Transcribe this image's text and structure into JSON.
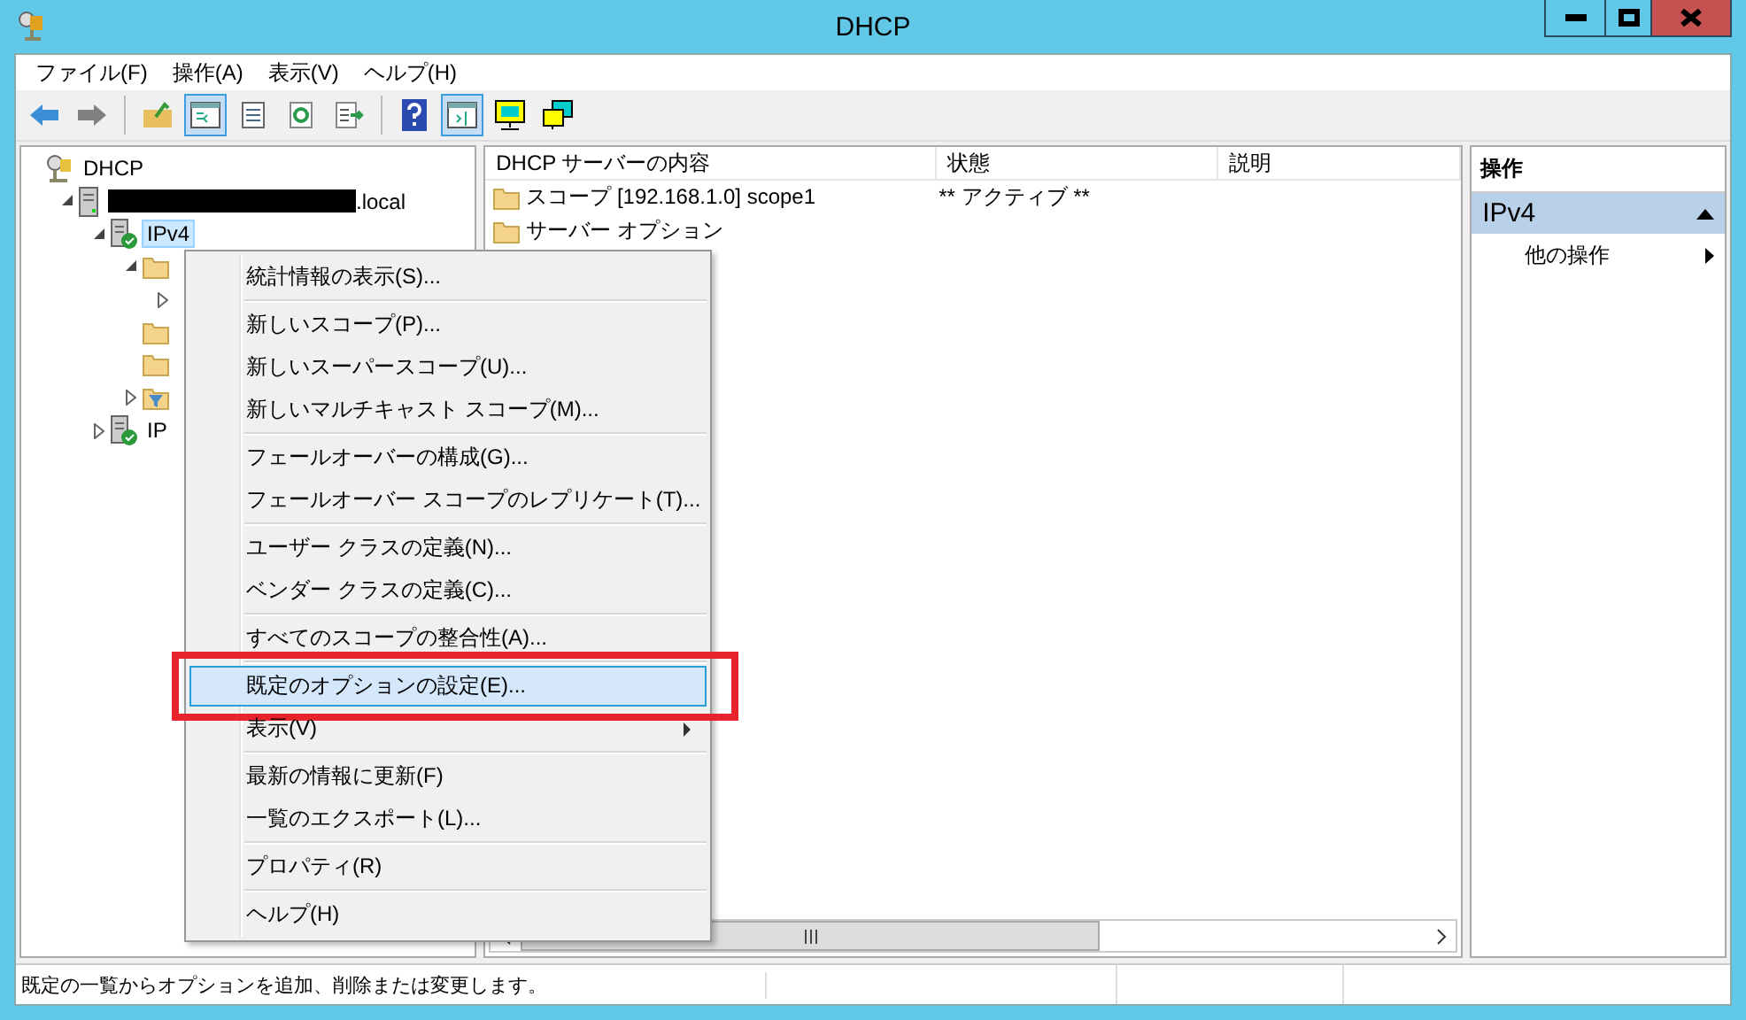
{
  "window": {
    "title": "DHCP"
  },
  "menubar": [
    "ファイル(F)",
    "操作(A)",
    "表示(V)",
    "ヘルプ(H)"
  ],
  "toolbar": [
    {
      "kind": "back",
      "pressed": false
    },
    {
      "kind": "forward",
      "pressed": false
    },
    {
      "kind": "separator"
    },
    {
      "kind": "up",
      "pressed": false
    },
    {
      "kind": "tree",
      "pressed": true
    },
    {
      "kind": "list",
      "pressed": false
    },
    {
      "kind": "refresh",
      "pressed": false
    },
    {
      "kind": "export",
      "pressed": false
    },
    {
      "kind": "separator"
    },
    {
      "kind": "help",
      "pressed": false
    },
    {
      "kind": "pane",
      "pressed": true
    },
    {
      "kind": "monitor",
      "pressed": false
    },
    {
      "kind": "monitors",
      "pressed": false
    }
  ],
  "tree": [
    {
      "kind": "dhcp",
      "label": "DHCP",
      "selected": false,
      "children": [
        {
          "kind": "server",
          "label": ".local",
          "redacted": true,
          "expanded": true,
          "selected": false,
          "children": [
            {
              "kind": "ipv4",
              "label": "IPv4",
              "expanded": true,
              "selected": true,
              "children": [
                {
                  "kind": "folder",
                  "expanded": true,
                  "children": [
                    {
                      "expanded": false
                    }
                  ]
                },
                {
                  "kind": "folder"
                },
                {
                  "kind": "folder"
                },
                {
                  "kind": "filter",
                  "expanded": false
                }
              ]
            },
            {
              "kind": "ipv4",
              "label": "IP",
              "expanded": false,
              "selected": false
            }
          ]
        }
      ]
    }
  ],
  "list": {
    "columns": [
      "DHCP サーバーの内容",
      "状態",
      "説明"
    ],
    "rows": [
      {
        "cells": [
          "スコープ [192.168.1.0] scope1",
          "** アクティブ **",
          ""
        ]
      },
      {
        "cells": [
          "サーバー オプション",
          "",
          ""
        ]
      }
    ]
  },
  "actions": {
    "header": "操作",
    "section": {
      "title": "IPv4",
      "expanded": true
    },
    "items": [
      {
        "label": "他の操作",
        "submenu": true
      }
    ]
  },
  "context_menu": [
    {
      "kind": "item",
      "label": "統計情報の表示(S)...",
      "selected": false,
      "submenu": false
    },
    {
      "kind": "separator"
    },
    {
      "kind": "item",
      "label": "新しいスコープ(P)...",
      "selected": false,
      "submenu": false
    },
    {
      "kind": "item",
      "label": "新しいスーパースコープ(U)...",
      "selected": false,
      "submenu": false
    },
    {
      "kind": "item",
      "label": "新しいマルチキャスト スコープ(M)...",
      "selected": false,
      "submenu": false
    },
    {
      "kind": "separator"
    },
    {
      "kind": "item",
      "label": "フェールオーバーの構成(G)...",
      "selected": false,
      "submenu": false
    },
    {
      "kind": "item",
      "label": "フェールオーバー スコープのレプリケート(T)...",
      "selected": false,
      "submenu": false
    },
    {
      "kind": "separator"
    },
    {
      "kind": "item",
      "label": "ユーザー クラスの定義(N)...",
      "selected": false,
      "submenu": false
    },
    {
      "kind": "item",
      "label": "ベンダー クラスの定義(C)...",
      "selected": false,
      "submenu": false
    },
    {
      "kind": "separator"
    },
    {
      "kind": "item",
      "label": "すべてのスコープの整合性(A)...",
      "selected": false,
      "submenu": false
    },
    {
      "kind": "separator"
    },
    {
      "kind": "item",
      "label": "既定のオプションの設定(E)...",
      "selected": true,
      "submenu": false,
      "highlighted_frame": true
    },
    {
      "kind": "item",
      "label": "表示(V)",
      "selected": false,
      "submenu": true
    },
    {
      "kind": "separator"
    },
    {
      "kind": "item",
      "label": "最新の情報に更新(F)",
      "selected": false,
      "submenu": false
    },
    {
      "kind": "item",
      "label": "一覧のエクスポート(L)...",
      "selected": false,
      "submenu": false
    },
    {
      "kind": "separator"
    },
    {
      "kind": "item",
      "label": "プロパティ(R)",
      "selected": false,
      "submenu": false
    },
    {
      "kind": "separator"
    },
    {
      "kind": "item",
      "label": "ヘルプ(H)",
      "selected": false,
      "submenu": false
    }
  ],
  "status_bar": "既定の一覧からオプションを追加、削除または変更します。"
}
